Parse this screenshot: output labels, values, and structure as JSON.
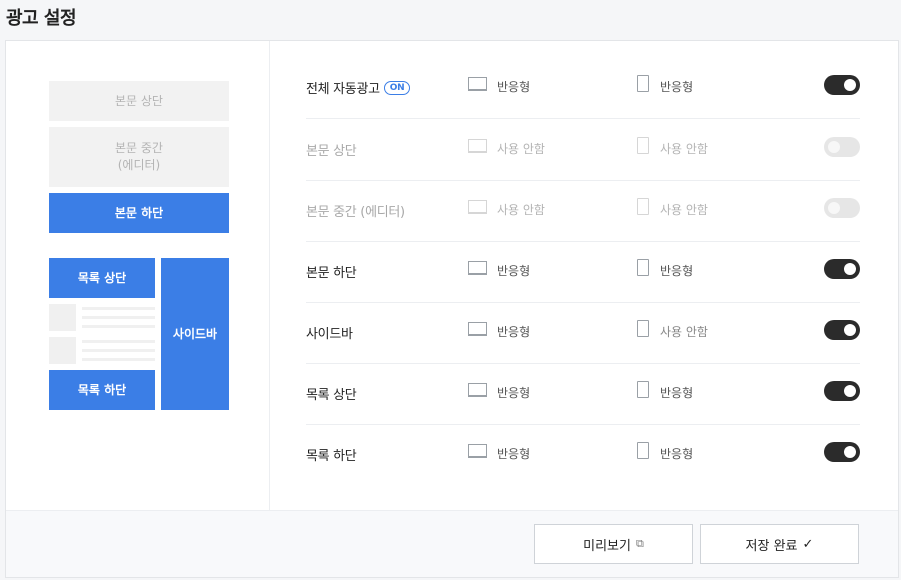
{
  "page": {
    "title": "광고 설정"
  },
  "preview": {
    "body_top": "본문 상단",
    "body_middle_line1": "본문 중간",
    "body_middle_line2": "(에디터)",
    "body_bottom": "본문 하단",
    "list_top": "목록 상단",
    "list_bottom": "목록 하단",
    "sidebar": "사이드바"
  },
  "rows": [
    {
      "label": "전체 자동광고",
      "badge": "ON",
      "pc": "반응형",
      "mobile": "반응형",
      "enabled": true
    },
    {
      "label": "본문 상단",
      "pc": "사용 안함",
      "mobile": "사용 안함",
      "enabled": false
    },
    {
      "label": "본문 중간 (에디터)",
      "pc": "사용 안함",
      "mobile": "사용 안함",
      "enabled": false
    },
    {
      "label": "본문 하단",
      "pc": "반응형",
      "mobile": "반응형",
      "enabled": true
    },
    {
      "label": "사이드바",
      "pc": "반응형",
      "mobile": "사용 안함",
      "enabled": true
    },
    {
      "label": "목록 상단",
      "pc": "반응형",
      "mobile": "반응형",
      "enabled": true
    },
    {
      "label": "목록 하단",
      "pc": "반응형",
      "mobile": "반응형",
      "enabled": true
    }
  ],
  "footer": {
    "preview_label": "미리보기",
    "save_label": "저장 완료"
  },
  "icons": {
    "pc": "monitor-icon",
    "mobile": "phone-icon",
    "external": "external-link-icon",
    "check": "check-icon"
  },
  "colors": {
    "accent": "#3b7ee6",
    "toggle_on": "#2b2b2b",
    "toggle_off": "#e6e6e6"
  }
}
